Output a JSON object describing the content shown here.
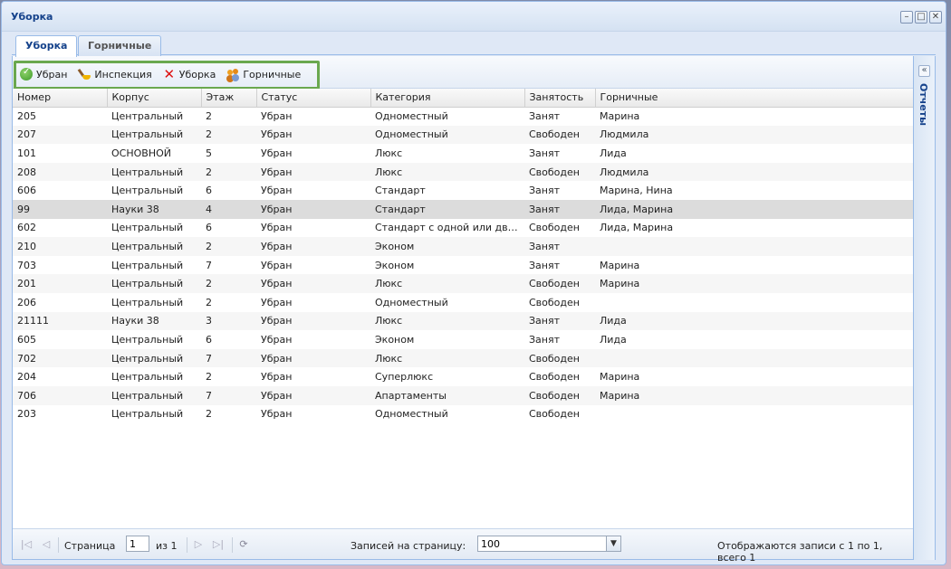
{
  "window": {
    "title": "Уборка",
    "tools": [
      "–",
      "□",
      "✕"
    ]
  },
  "tabs": [
    {
      "label": "Уборка",
      "active": true
    },
    {
      "label": "Горничные",
      "active": false
    }
  ],
  "toolbar": {
    "buttons": [
      {
        "label": "Убран",
        "icon": "check-circle-icon"
      },
      {
        "label": "Инспекция",
        "icon": "broom-icon"
      },
      {
        "label": "Уборка",
        "icon": "red-x-icon"
      },
      {
        "label": "Горничные",
        "icon": "maids-icon"
      }
    ],
    "highlight_color": "#6aa84f"
  },
  "side_panel": {
    "collapse_glyph": "«",
    "label": "Отчеты"
  },
  "grid": {
    "columns": [
      "Номер",
      "Корпус",
      "Этаж",
      "Статус",
      "Категория",
      "Занятость",
      "Горничные"
    ],
    "rows": [
      [
        "205",
        "Центральный",
        "2",
        "Убран",
        "Одноместный",
        "Занят",
        "Марина"
      ],
      [
        "207",
        "Центральный",
        "2",
        "Убран",
        "Одноместный",
        "Свободен",
        "Людмила"
      ],
      [
        "101",
        "ОСНОВНОЙ",
        "5",
        "Убран",
        "Люкс",
        "Занят",
        "Лида"
      ],
      [
        "208",
        "Центральный",
        "2",
        "Убран",
        "Люкс",
        "Свободен",
        "Людмила"
      ],
      [
        "606",
        "Центральный",
        "6",
        "Убран",
        "Стандарт",
        "Занят",
        "Марина, Нина"
      ],
      [
        "99",
        "Науки 38",
        "4",
        "Убран",
        "Стандарт",
        "Занят",
        "Лида, Марина"
      ],
      [
        "602",
        "Центральный",
        "6",
        "Убран",
        "Стандарт с одной или двум...",
        "Свободен",
        "Лида, Марина"
      ],
      [
        "210",
        "Центральный",
        "2",
        "Убран",
        "Эконом",
        "Занят",
        ""
      ],
      [
        "703",
        "Центральный",
        "7",
        "Убран",
        "Эконом",
        "Занят",
        "Марина"
      ],
      [
        "201",
        "Центральный",
        "2",
        "Убран",
        "Люкс",
        "Свободен",
        "Марина"
      ],
      [
        "206",
        "Центральный",
        "2",
        "Убран",
        "Одноместный",
        "Свободен",
        ""
      ],
      [
        "21111",
        "Науки 38",
        "3",
        "Убран",
        "Люкс",
        "Занят",
        "Лида"
      ],
      [
        "605",
        "Центральный",
        "6",
        "Убран",
        "Эконом",
        "Занят",
        "Лида"
      ],
      [
        "702",
        "Центральный",
        "7",
        "Убран",
        "Люкс",
        "Свободен",
        ""
      ],
      [
        "204",
        "Центральный",
        "2",
        "Убран",
        "Суперлюкс",
        "Свободен",
        "Марина"
      ],
      [
        "706",
        "Центральный",
        "7",
        "Убран",
        "Апартаменты",
        "Свободен",
        "Марина"
      ],
      [
        "203",
        "Центральный",
        "2",
        "Убран",
        "Одноместный",
        "Свободен",
        ""
      ]
    ],
    "selected_row": 5
  },
  "pager": {
    "page_label": "Страница",
    "page_value": "1",
    "of_label": "из 1",
    "per_page_label": "Записей на страницу:",
    "per_page_value": "100",
    "status": "Отображаются записи с 1 по 1, всего 1"
  }
}
